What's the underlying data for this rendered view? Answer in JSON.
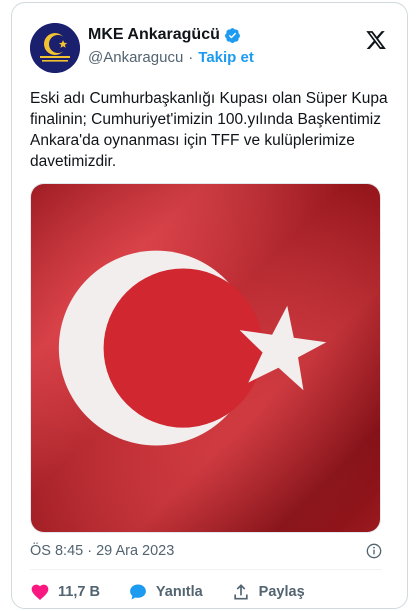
{
  "user": {
    "display_name": "MKE Ankaragücü",
    "handle": "@Ankaragucu",
    "separator": "·",
    "follow_label": "Takip et",
    "avatar_text": "MKE ANKARAGÜCÜ"
  },
  "tweet": {
    "text": "Eski adı Cumhurbaşkanlığı Kupası olan Süper Kupa finalinin; Cumhuriyet'imizin 100.yılında Başkentimiz Ankara'da oynanması için TFF ve kulüplerimize davetimizdir.",
    "media_description": "Turkish flag",
    "timestamp": "ÖS 8:45 · 29 Ara 2023"
  },
  "actions": {
    "like_count": "11,7 B",
    "reply_label": "Yanıtla",
    "share_label": "Paylaş"
  },
  "colors": {
    "accent": "#1d9bf0",
    "like": "#f91880",
    "flag_red": "#d8262e",
    "text_secondary": "#536471"
  },
  "icons": [
    "verified-badge-icon",
    "x-logo-icon",
    "info-icon",
    "heart-icon",
    "reply-bubble-icon",
    "share-icon"
  ]
}
